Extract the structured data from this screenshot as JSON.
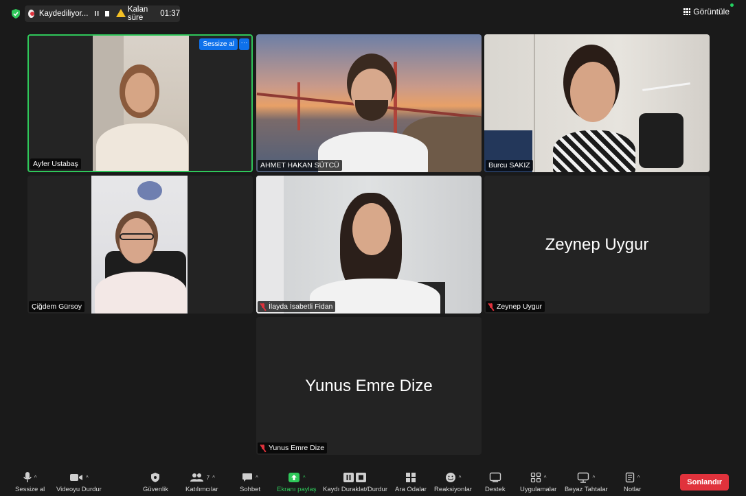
{
  "topbar": {
    "recording_label": "Kaydediliyor...",
    "pause_glyph": "II",
    "remaining_label": "Kalan süre",
    "remaining_time": "01:37",
    "view_label": "Görüntüle"
  },
  "tiles": {
    "t1": {
      "name": "Ayfer Ustabaş",
      "mute_button": "Sessize al",
      "more_glyph": "···"
    },
    "t2": {
      "name": "AHMET HAKAN SÜTCÜ"
    },
    "t3": {
      "name": "Burcu SAKIZ"
    },
    "t4": {
      "name": "Çiğdem Gürsoy"
    },
    "t5": {
      "name": "İlayda İsabetli Fidan"
    },
    "t6": {
      "name": "Zeynep Uygur",
      "display_name": "Zeynep Uygur"
    },
    "t7": {
      "name": "Yunus Emre Dize",
      "display_name": "Yunus Emre Dize"
    }
  },
  "toolbar": {
    "mute": "Sessize al",
    "video": "Videoyu Durdur",
    "security": "Güvenlik",
    "participants": "Katılımcılar",
    "participants_count": "7",
    "chat": "Sohbet",
    "share": "Ekranı paylaş",
    "record": "Kaydı Duraklat/Durdur",
    "breakout": "Ara Odalar",
    "reactions": "Reaksiyonlar",
    "support": "Destek",
    "apps": "Uygulamalar",
    "whiteboards": "Beyaz Tahtalar",
    "notes": "Notlar",
    "end": "Sonlandır"
  },
  "colors": {
    "accent_green": "#2fc85a",
    "accent_blue": "#0e71eb",
    "end_red": "#e0323c"
  }
}
